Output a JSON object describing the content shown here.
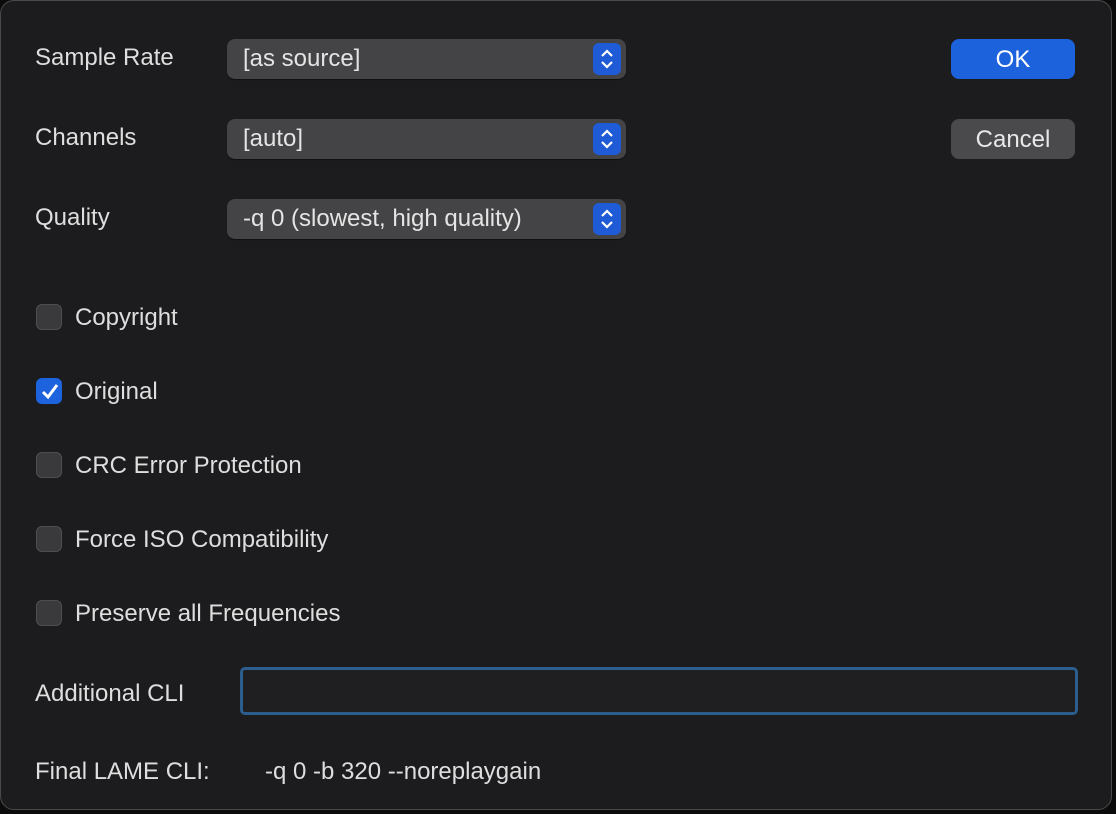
{
  "form": {
    "sample_rate": {
      "label": "Sample Rate",
      "value": "[as source]"
    },
    "channels": {
      "label": "Channels",
      "value": "[auto]"
    },
    "quality": {
      "label": "Quality",
      "value": "-q 0 (slowest, high quality)"
    },
    "checkboxes": [
      {
        "label": "Copyright",
        "checked": false
      },
      {
        "label": "Original",
        "checked": true
      },
      {
        "label": "CRC Error Protection",
        "checked": false
      },
      {
        "label": "Force ISO Compatibility",
        "checked": false
      },
      {
        "label": "Preserve all Frequencies",
        "checked": false
      }
    ],
    "additional_cli": {
      "label": "Additional CLI",
      "value": ""
    },
    "final_cli": {
      "label": "Final LAME CLI:",
      "value": "-q 0 -b 320 --noreplaygain"
    }
  },
  "buttons": {
    "ok": "OK",
    "cancel": "Cancel"
  },
  "colors": {
    "accent": "#1b62dc",
    "focus_ring": "#2b5e8e",
    "background": "#1c1c1e"
  }
}
